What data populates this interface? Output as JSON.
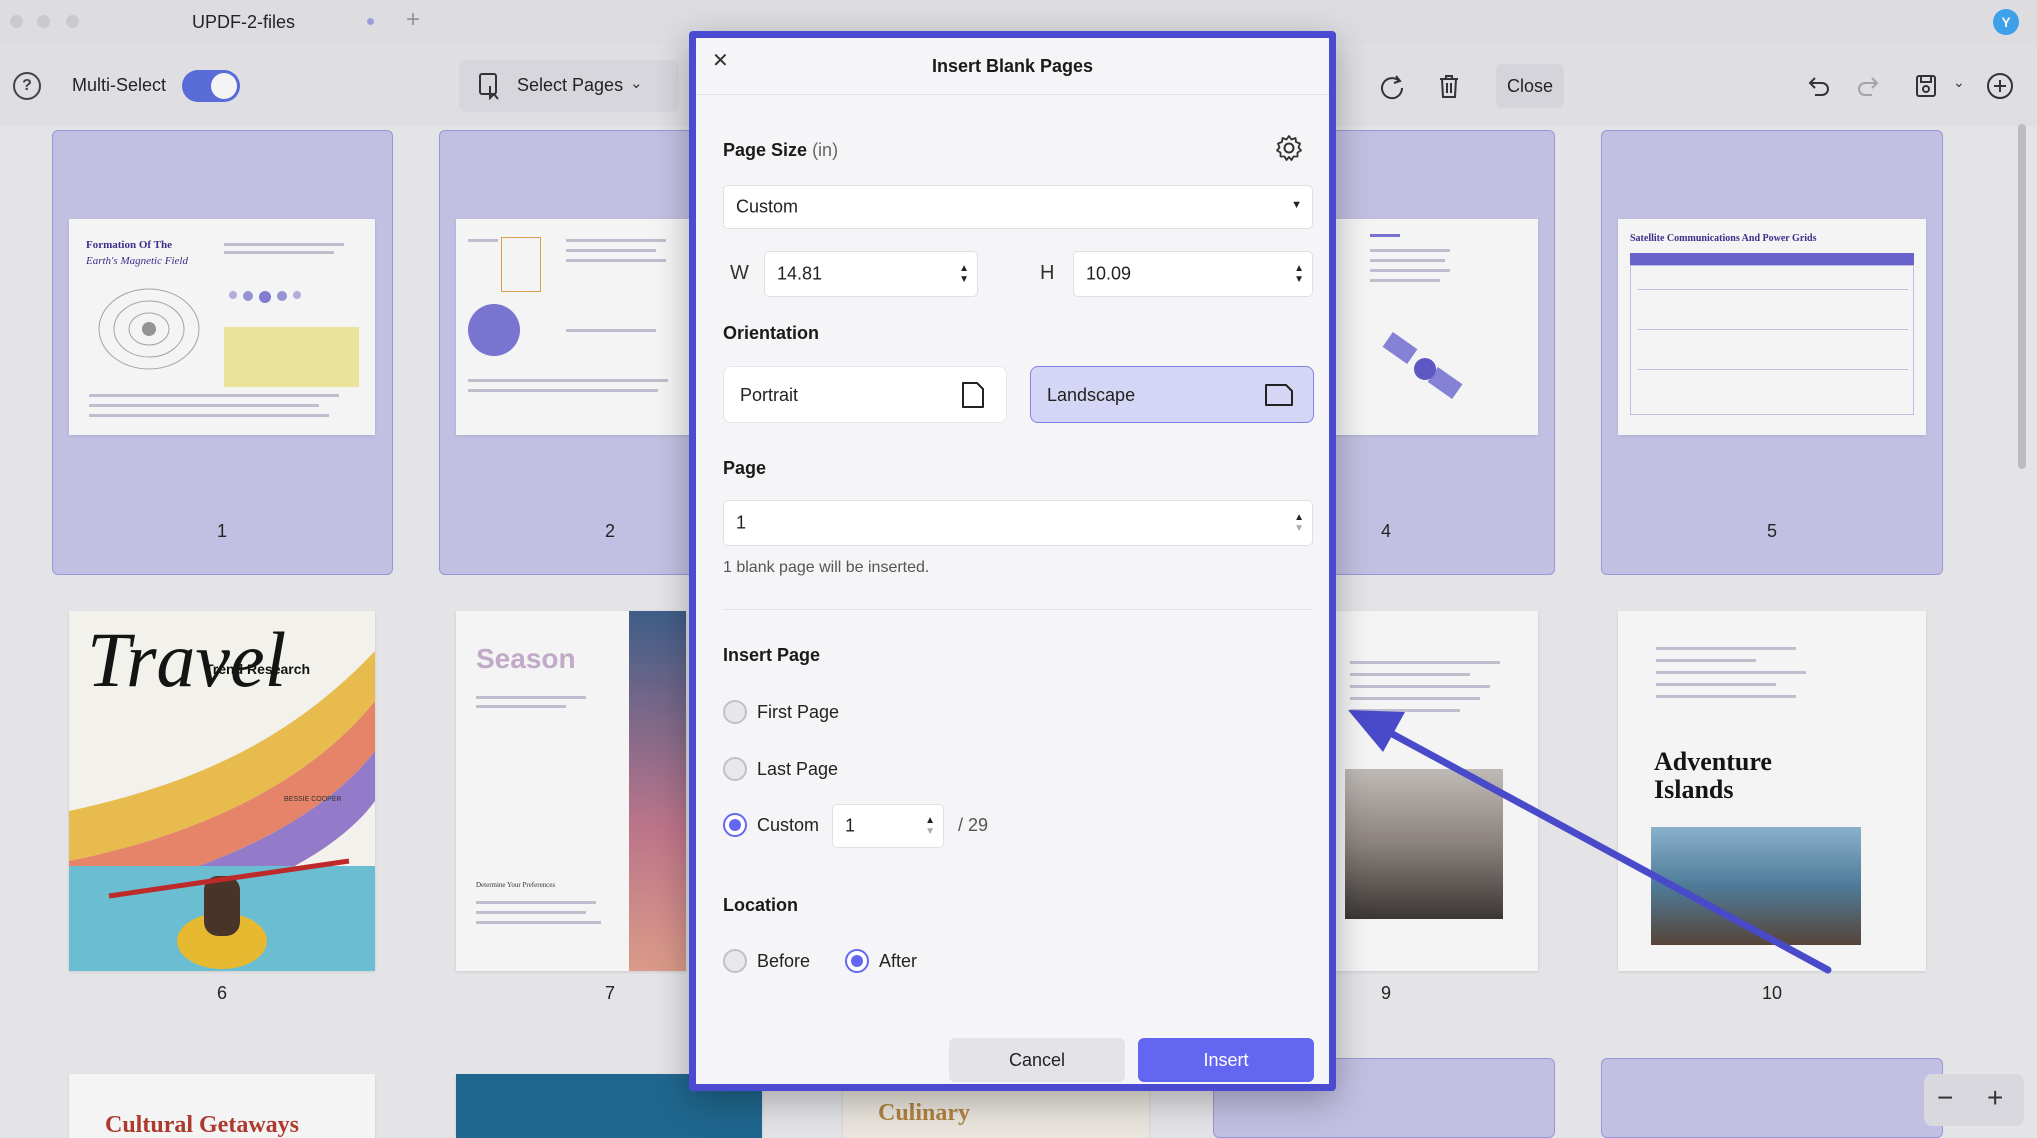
{
  "window": {
    "title": "UPDF-2-files",
    "avatar_initial": "Y"
  },
  "toolbar": {
    "multi_select_label": "Multi-Select",
    "multi_select_on": true,
    "select_pages_label": "Select Pages",
    "close_label": "Close"
  },
  "pages": {
    "numbers": [
      "1",
      "2",
      "4",
      "5",
      "6",
      "7",
      "9",
      "10"
    ],
    "p1_title": "Formation Of The",
    "p1_subtitle": "Earth's Magnetic Field",
    "p5_title": "Satellite Communications And Power Grids",
    "p6_script": "Travel",
    "p6_overlay": "Trend Research",
    "p6_author": "BESSIE COOPER",
    "p7_title": "Season",
    "p7_heading": "Determine Your Preferences",
    "p10_title_line1": "Adventure",
    "p10_title_line2": "Islands",
    "bottom_left_title": "Cultural Getaways",
    "bottom_mid_title": "Culinary"
  },
  "dialog": {
    "title": "Insert Blank Pages",
    "page_size_label": "Page Size",
    "page_size_unit": "(in)",
    "size_preset": "Custom",
    "width_label": "W",
    "width_value": "14.81",
    "height_label": "H",
    "height_value": "10.09",
    "orientation_label": "Orientation",
    "portrait_label": "Portrait",
    "landscape_label": "Landscape",
    "selected_orientation": "Landscape",
    "page_label": "Page",
    "page_count_value": "1",
    "page_hint": "1 blank page will be inserted.",
    "insert_page_label": "Insert Page",
    "first_page_label": "First Page",
    "last_page_label": "Last Page",
    "custom_label": "Custom",
    "custom_value": "1",
    "total_pages": "/ 29",
    "selected_insert_option": "Custom",
    "location_label": "Location",
    "before_label": "Before",
    "after_label": "After",
    "selected_location": "After",
    "cancel_label": "Cancel",
    "insert_label": "Insert"
  },
  "colors": {
    "accent": "#6366f1",
    "dialog_border": "#4a4bd1",
    "selected_tile": "#c9c8eb",
    "annotation_arrow": "#4a4bd1"
  }
}
